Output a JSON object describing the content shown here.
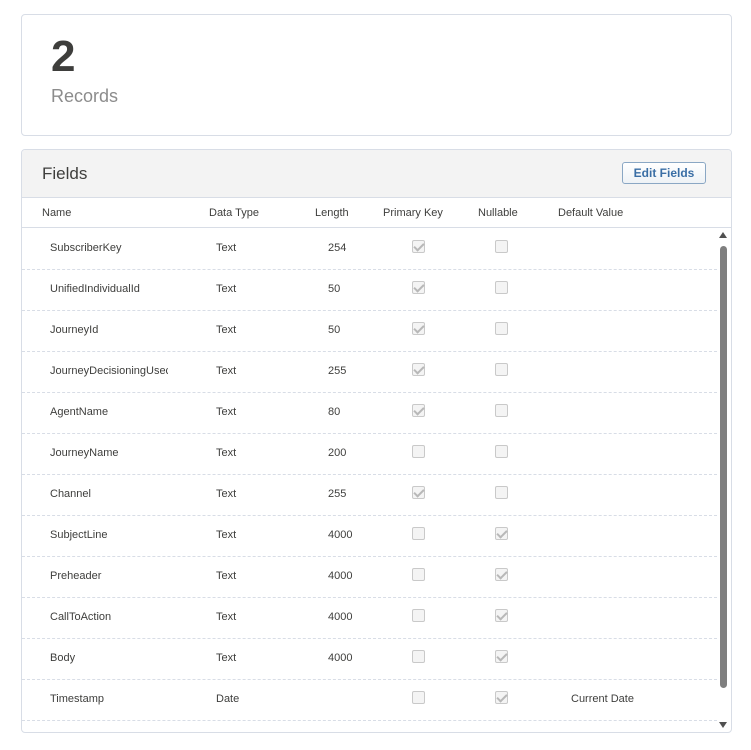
{
  "summary": {
    "count": "2",
    "label": "Records"
  },
  "fields_panel": {
    "title": "Fields",
    "edit_label": "Edit Fields",
    "columns": [
      "Name",
      "Data Type",
      "Length",
      "Primary Key",
      "Nullable",
      "Default Value"
    ],
    "rows": [
      {
        "name": "SubscriberKey",
        "type": "Text",
        "length": "254",
        "primary_key": true,
        "nullable": false,
        "default": ""
      },
      {
        "name": "UnifiedIndividualId",
        "type": "Text",
        "length": "50",
        "primary_key": true,
        "nullable": false,
        "default": ""
      },
      {
        "name": "JourneyId",
        "type": "Text",
        "length": "50",
        "primary_key": true,
        "nullable": false,
        "default": ""
      },
      {
        "name": "JourneyDecisioningUsec",
        "type": "Text",
        "length": "255",
        "primary_key": true,
        "nullable": false,
        "default": ""
      },
      {
        "name": "AgentName",
        "type": "Text",
        "length": "80",
        "primary_key": true,
        "nullable": false,
        "default": ""
      },
      {
        "name": "JourneyName",
        "type": "Text",
        "length": "200",
        "primary_key": false,
        "nullable": false,
        "default": ""
      },
      {
        "name": "Channel",
        "type": "Text",
        "length": "255",
        "primary_key": true,
        "nullable": false,
        "default": ""
      },
      {
        "name": "SubjectLine",
        "type": "Text",
        "length": "4000",
        "primary_key": false,
        "nullable": true,
        "default": ""
      },
      {
        "name": "Preheader",
        "type": "Text",
        "length": "4000",
        "primary_key": false,
        "nullable": true,
        "default": ""
      },
      {
        "name": "CallToAction",
        "type": "Text",
        "length": "4000",
        "primary_key": false,
        "nullable": true,
        "default": ""
      },
      {
        "name": "Body",
        "type": "Text",
        "length": "4000",
        "primary_key": false,
        "nullable": true,
        "default": ""
      },
      {
        "name": "Timestamp",
        "type": "Date",
        "length": "",
        "primary_key": false,
        "nullable": true,
        "default": "Current Date"
      }
    ]
  },
  "colors": {
    "border": "#d8dde6",
    "header_bg": "#f3f3f3",
    "button_text": "#3a6ea5"
  }
}
